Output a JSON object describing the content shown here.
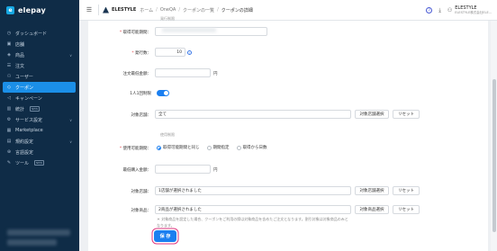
{
  "sidebar": {
    "logo": "elepay",
    "items": [
      {
        "label": "ダッシュボード",
        "icon": "clock-icon"
      },
      {
        "label": "店舗",
        "icon": "store-icon"
      },
      {
        "label": "商品",
        "icon": "tag-icon"
      },
      {
        "label": "注文",
        "icon": "receipt-icon"
      },
      {
        "label": "ユーザー",
        "icon": "user-icon"
      },
      {
        "label": "クーポン",
        "icon": "coupon-icon"
      },
      {
        "label": "キャンペーン",
        "icon": "megaphone-icon"
      },
      {
        "label": "統計",
        "icon": "stats-icon",
        "badge": "NEW"
      },
      {
        "label": "サービス設定",
        "icon": "gear-icon"
      },
      {
        "label": "Marketplace",
        "icon": "marketplace-icon"
      },
      {
        "label": "規約設定",
        "icon": "document-icon"
      },
      {
        "label": "言語設定",
        "icon": "language-icon"
      },
      {
        "label": "ツール",
        "icon": "wrench-icon",
        "badge": "NEW"
      }
    ]
  },
  "header": {
    "brand": "ELESTYLE",
    "breadcrumb": [
      "ホーム",
      "OneQA",
      "クーポンの一覧",
      "クーポンの詳細"
    ],
    "user_name": "ELESTYLE",
    "user_sub": "ELESTYLE株式会社ELE..."
  },
  "form": {
    "section_issue": "発行制限",
    "issue_period_label": "取得可能期間：",
    "issue_count_label": "発行数：",
    "issue_count_value": "10",
    "min_order_label": "注文最低金額：",
    "currency_unit": "円",
    "one_per_day_label": "1人1回制限",
    "target_store_label": "対象店舗：",
    "target_store_value": "全て",
    "select_store_btn": "対象店舗選択",
    "reset_btn": "リセット",
    "section_usage": "使用制限",
    "usage_period_label": "使用可能期間：",
    "usage_period_options": [
      "取得可能期間と同じ",
      "期間指定",
      "取得から日数"
    ],
    "min_purchase_label": "最低購入金額：",
    "usage_store_label": "対象店舗：",
    "usage_store_value": "1店舗が選択されました",
    "target_product_label": "対象商品：",
    "target_product_value": "2商品が選択されました",
    "select_product_btn": "対象商品選択",
    "note": "＊ 対象商品を設定した場合、クーポンをご利用の際は対象商品を含めたご注文となります。割引対象は対象商品のみとなります。",
    "save_btn": "保 存"
  },
  "colors": {
    "sidebar_bg": "#0f2c47",
    "accent": "#1b7ff0",
    "highlight": "#e0367f"
  }
}
